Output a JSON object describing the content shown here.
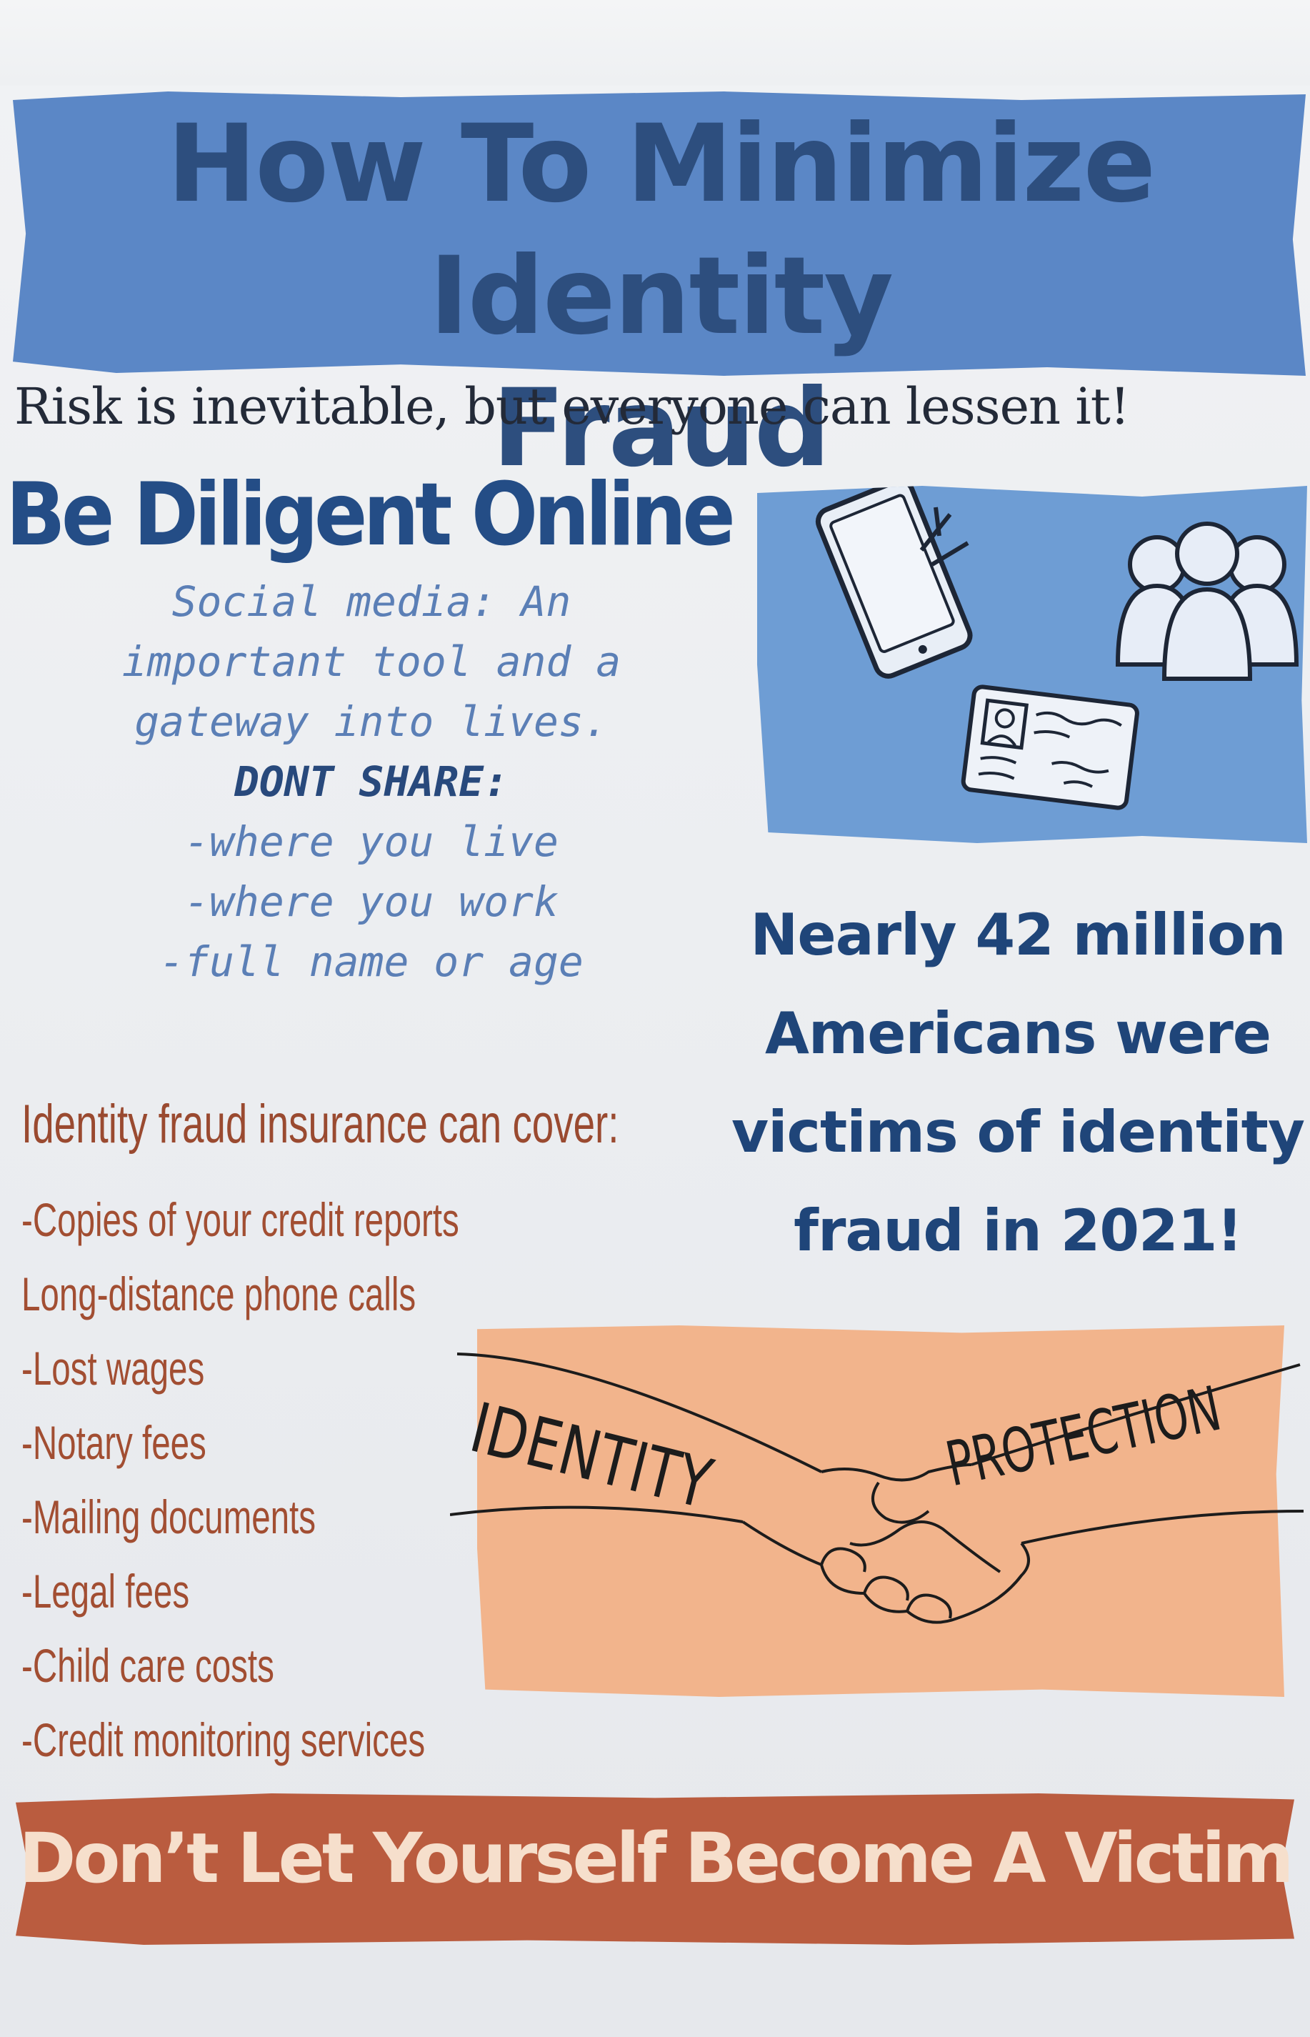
{
  "poster": {
    "title_line1": "How To Minimize Identity",
    "title_line2": "Fraud",
    "subtitle": "Risk is inevitable, but everyone can lessen it!",
    "diligent_heading": "Be Diligent Online",
    "social_lines": [
      "Social media: An",
      "important tool and a",
      "gateway into lives."
    ],
    "dont_share_label": "DONT SHARE:",
    "dont_share_items": [
      "-where you live",
      "-where you work",
      "-full name or age"
    ],
    "stat_lines": [
      "Nearly 42 million",
      "Americans were",
      "victims of identity",
      "fraud in 2021!"
    ],
    "insurance_heading": "Identity fraud insurance can cover:",
    "insurance_items": [
      "-Copies of your credit reports",
      "Long-distance phone calls",
      "-Lost wages",
      "-Notary fees",
      "-Mailing documents",
      "-Legal fees",
      "-Child care costs",
      "-Credit monitoring services"
    ],
    "handshake_left_word": "IDENTITY",
    "handshake_right_word": "PROTECTION",
    "footer": "Don’t Let Yourself Become A Victim"
  },
  "icons": [
    "phone-icon",
    "people-icon",
    "id-card-icon",
    "handshake-icon"
  ],
  "colors": {
    "title_banner": "#5b87c6",
    "title_text": "#2d4e7e",
    "heading_blue": "#244d86",
    "mono_text": "#5b7fb6",
    "insurance_text": "#a24e32",
    "peach_panel": "#f2b48c",
    "footer_banner": "#ba5c3f",
    "footer_text": "#f6dfcc"
  }
}
